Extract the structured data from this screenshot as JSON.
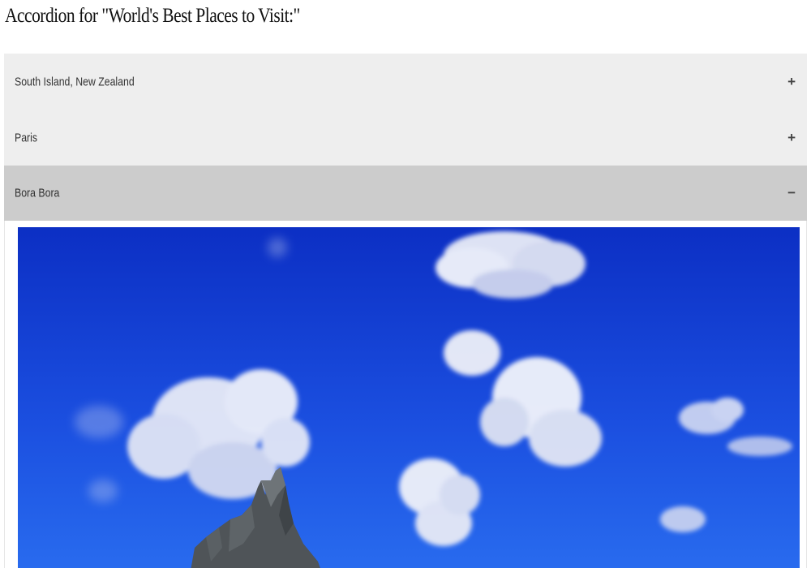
{
  "page": {
    "title": "Accordion for \"World's Best Places to Visit:\""
  },
  "accordion": {
    "items": [
      {
        "label": "South Island, New Zealand",
        "icon": "plus-icon",
        "sign": "+",
        "expanded": false
      },
      {
        "label": "Paris",
        "icon": "plus-icon",
        "sign": "+",
        "expanded": false
      },
      {
        "label": "Bora Bora",
        "icon": "minus-icon",
        "sign": "−",
        "expanded": true
      }
    ],
    "colors": {
      "header_background": "#eeeeee",
      "active_header_background": "#cccccc",
      "sky_top": "#0c2fc4",
      "sky_bottom": "#2a6ef0"
    }
  }
}
